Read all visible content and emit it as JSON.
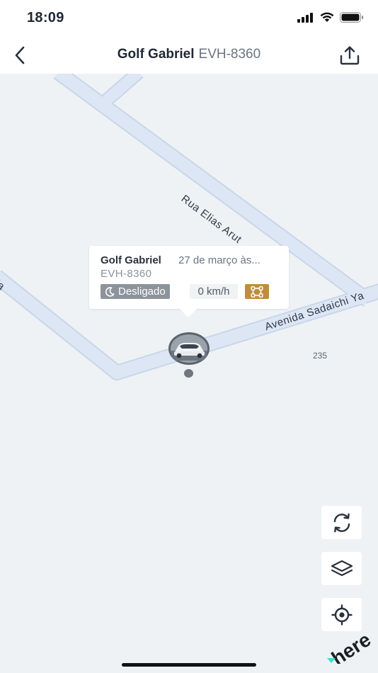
{
  "status_bar": {
    "time": "18:09"
  },
  "header": {
    "title": "Golf Gabriel",
    "plate": "EVH-8360"
  },
  "map": {
    "road_labels": [
      "Rua Elias Arut",
      "Avenida Sadaichi Ya",
      "ia"
    ],
    "house_number": "235",
    "logo": "here"
  },
  "popup": {
    "vehicle_name": "Golf Gabriel",
    "timestamp": "27 de março às...",
    "plate": "EVH-8360",
    "status": "Desligado",
    "speed": "0 km/h"
  },
  "map_controls": {
    "icons": [
      "refresh-icon",
      "layers-icon",
      "locate-icon"
    ]
  },
  "colors": {
    "geofence_badge": "#bd8f3d",
    "status_badge": "#8d939b",
    "road": "#dde6f4",
    "map_bg": "#eef2f4"
  }
}
